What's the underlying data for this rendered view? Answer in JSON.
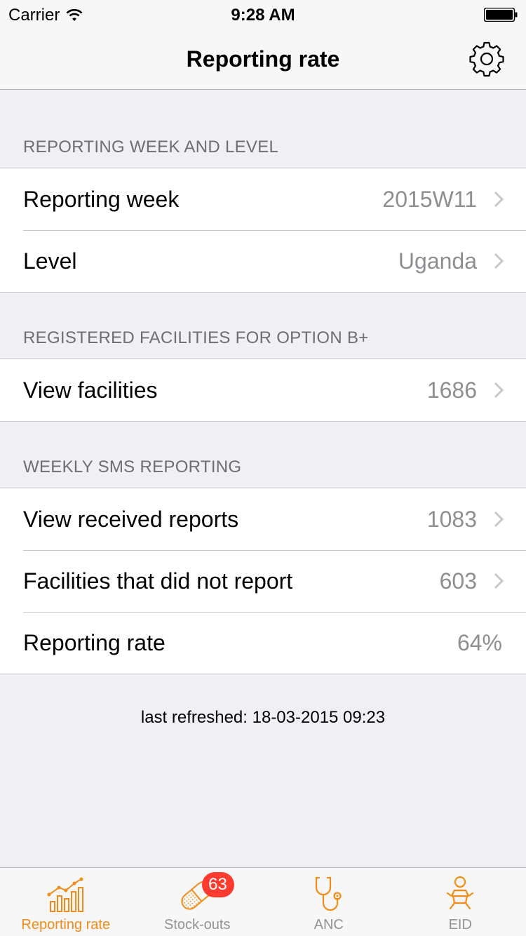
{
  "status_bar": {
    "carrier": "Carrier",
    "time": "9:28 AM"
  },
  "nav": {
    "title": "Reporting rate",
    "settings_icon": "gear-icon"
  },
  "sections": [
    {
      "header": "REPORTING WEEK AND LEVEL",
      "rows": [
        {
          "label": "Reporting week",
          "value": "2015W11"
        },
        {
          "label": "Level",
          "value": "Uganda"
        }
      ]
    },
    {
      "header": "REGISTERED FACILITIES FOR OPTION B+",
      "rows": [
        {
          "label": "View facilities",
          "value": "1686"
        }
      ]
    },
    {
      "header": "WEEKLY SMS REPORTING",
      "rows": [
        {
          "label": "View received reports",
          "value": "1083"
        },
        {
          "label": "Facilities that did not report",
          "value": "603"
        },
        {
          "label": "Reporting rate",
          "value": "64%"
        }
      ]
    }
  ],
  "footer": {
    "last_refreshed": "last refreshed: 18-03-2015 09:23"
  },
  "tabbar": {
    "tabs": [
      {
        "label": "Reporting rate",
        "icon": "chart-icon",
        "active": true
      },
      {
        "label": "Stock-outs",
        "icon": "pill-icon",
        "badge": "63"
      },
      {
        "label": "ANC",
        "icon": "stethoscope-icon"
      },
      {
        "label": "EID",
        "icon": "baby-icon"
      }
    ]
  },
  "colors": {
    "accent": "#f28c18",
    "badge": "#ff3b30",
    "background": "#efeff4",
    "secondary_text": "#8e8e93"
  }
}
